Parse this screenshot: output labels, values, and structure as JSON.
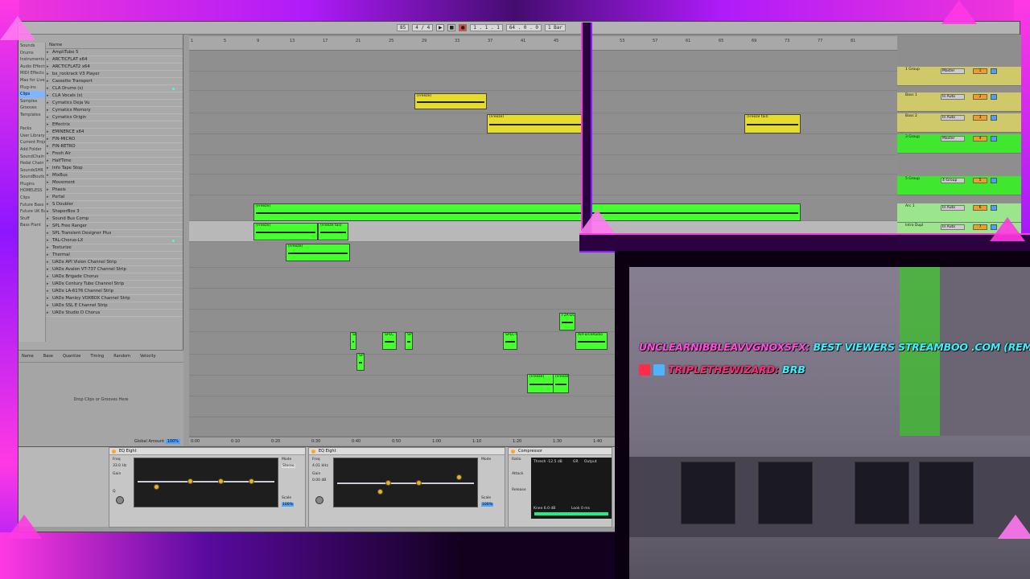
{
  "transport": {
    "tempo": "85",
    "time_sig": "4 / 4",
    "bar": "1 Bar",
    "position": "1 . 1 . 1",
    "end": "64 . 0 . 0"
  },
  "browser": {
    "places": [
      "Sounds",
      "Drums",
      "Instruments",
      "Audio Effects",
      "MIDI Effects",
      "Max for Live",
      "Plug-ins",
      "Clips",
      "Samples",
      "Grooves",
      "Templates",
      "",
      "Packs",
      "User Library",
      "Current Project",
      "Add Folder",
      "SoundChain",
      "Pedal Chain",
      "SoundsSHR",
      "SoundBoutk",
      "Plugins",
      "HOMELESS",
      "Clips",
      "Future Bass",
      "Future UK Bat",
      "Stuff",
      "Bass Plant"
    ],
    "name_header": "Name",
    "plugins": [
      "AmpliTube 5",
      "ARCTICFLAT x64",
      "ARCTICFLAT2 x64",
      "bx_rockrack V3 Player",
      "Cassette Transport",
      "CLA Drums (s)",
      "CLA Vocals (s)",
      "Cymatics Deja Vu",
      "Cymatics Memory",
      "Cymatics Origin",
      "Effectrix",
      "EMINENCE x64",
      "FIN-MICRO",
      "FIN-RETRO",
      "Fresh Air",
      "HalfTime",
      "Info Tape Stop",
      "MixBus",
      "Movement",
      "Phasis",
      "Portal",
      "S Doubler",
      "ShaperBox 3",
      "Sound Bus Comp",
      "SPL Free Ranger",
      "SPL Transient Designer Plus",
      "TAL-Chorus-LX",
      "Texturize",
      "Thermal",
      "UADx API Vision Channel Strip",
      "UADx Avalon VT-737 Channel Strip",
      "UADx Brigade Chorus",
      "UADx Century Tube Channel Strip",
      "UADx LA-6176 Channel Strip",
      "UADx Manley VOXBOX Channel Strip",
      "UADx SSL E Channel Strip",
      "UADx Studio D Chorus"
    ],
    "groove_headers": [
      "Name",
      "Base",
      "Quantize",
      "Timing",
      "Random",
      "Velocity"
    ],
    "groove_drop": "Drop Clips or Grooves Here",
    "global_amount_label": "Global Amount",
    "global_amount_value": "100%"
  },
  "arrangement": {
    "ruler_marks": [
      "1",
      "5",
      "9",
      "13",
      "17",
      "21",
      "25",
      "29",
      "33",
      "37",
      "41",
      "45",
      "49",
      "53",
      "57",
      "61",
      "65",
      "69",
      "73",
      "77",
      "81"
    ],
    "time_marks": [
      "0:00",
      "0:10",
      "0:20",
      "0:30",
      "0:40",
      "0:50",
      "1:00",
      "1:10",
      "1:20",
      "1:30",
      "1:40"
    ],
    "clips": [
      {
        "label": "(Freeze)",
        "color": "yellow"
      },
      {
        "label": "(Freeze)",
        "color": "yellow"
      },
      {
        "label": "(Freeze tail)",
        "color": "yellow"
      },
      {
        "label": "(Freeze)",
        "color": "green"
      },
      {
        "label": "(Freeze)",
        "color": "green"
      },
      {
        "label": "(Freeze tail)",
        "color": "green"
      },
      {
        "label": "(Freeze)",
        "color": "green"
      },
      {
        "label": "SPL",
        "color": "green"
      },
      {
        "label": "SPLC",
        "color": "green"
      },
      {
        "label": "SPL",
        "color": "green"
      },
      {
        "label": "SPLC-V",
        "color": "green"
      },
      {
        "label": "F2A-DO",
        "color": "green"
      },
      {
        "label": "AirForceRadio",
        "color": "green"
      },
      {
        "label": "SP",
        "color": "green"
      },
      {
        "label": "(Freeze)",
        "color": "green"
      },
      {
        "label": "(Freeze",
        "color": "green"
      }
    ]
  },
  "mixer": {
    "rows": [
      {
        "name": "1 Group",
        "io": "Master",
        "num": "1"
      },
      {
        "name": "Bass 1",
        "io": "In Auto",
        "num": "2"
      },
      {
        "name": "Bass 2",
        "io": "In Auto",
        "num": "3"
      },
      {
        "name": "3 Group",
        "io": "Master",
        "num": "4"
      },
      {
        "name": "5 Group",
        "io": "4-Group",
        "num": "5"
      },
      {
        "name": "Arc 1",
        "io": "In Auto",
        "num": "6"
      },
      {
        "name": "Intro Dupl",
        "io": "In Auto",
        "num": "7"
      }
    ]
  },
  "devices": {
    "eq1_title": "EQ Eight",
    "eq2_title": "EQ Eight",
    "comp_title": "Compressor",
    "comp_thresh": "Thresh -12.5 dB",
    "comp_gr": "GR",
    "comp_output": "Output",
    "eq_freq": "Freq",
    "eq_gain": "Gain",
    "eq_q": "Q",
    "eq_mode": "Mode",
    "eq_stereo": "Stereo",
    "eq_scale": "Scale",
    "eq_scale_val": "100%",
    "eq_freq_val1": "33.0 Hz",
    "eq_freq_val2": "4.01 kHz",
    "eq_gain_val": "0.00 dB",
    "comp_ratio": "Ratio",
    "comp_attack": "Attack",
    "comp_release": "Release",
    "comp_knee": "Knee",
    "comp_knee_val": "6.0 dB",
    "comp_look": "Look",
    "comp_look_val": "0 ms"
  },
  "chat": {
    "user1": "UNCLEARNIBBLEAVVGNOXSFX:",
    "msg1": "BEST VIEWERS STREAMBOO .COM (REMOVE THE SPA",
    "user2": "TRIPLETHEWIZARD:",
    "msg2": "BRB"
  },
  "colors": {
    "neon_pink": "#ff39e3",
    "neon_purple": "#8e15ff",
    "clip_yellow": "#e6dc2b",
    "clip_green": "#45ff2e",
    "chat_cyan": "#3cf2ff",
    "chat_user_pink": "#ff4bdb"
  }
}
